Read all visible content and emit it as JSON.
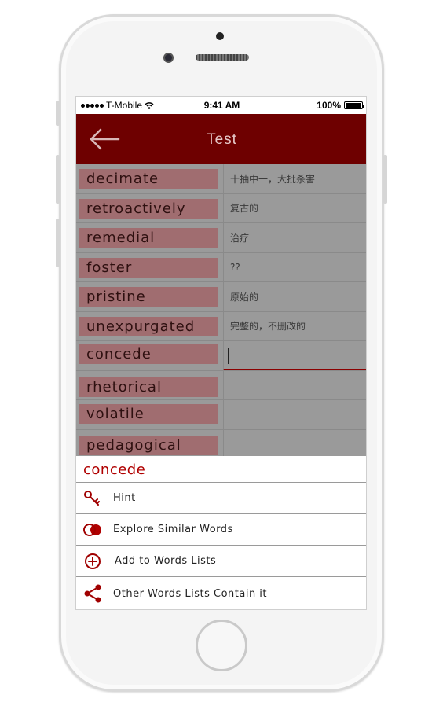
{
  "status_bar": {
    "carrier": "T-Mobile",
    "time": "9:41 AM",
    "battery": "100%"
  },
  "nav": {
    "title": "Test",
    "back_icon": "arrow-left-icon"
  },
  "words": [
    {
      "word": "decimate",
      "meaning": "十抽中一，大批杀害"
    },
    {
      "word": "retroactively",
      "meaning": "复古的"
    },
    {
      "word": "remedial",
      "meaning": "治疗"
    },
    {
      "word": "foster",
      "meaning": "??"
    },
    {
      "word": "pristine",
      "meaning": "原始的"
    },
    {
      "word": "unexpurgated",
      "meaning": "完整的，不删改的"
    },
    {
      "word": "concede",
      "meaning": ""
    },
    {
      "word": "rhetorical",
      "meaning": ""
    },
    {
      "word": "volatile",
      "meaning": ""
    },
    {
      "word": "pedagogical",
      "meaning": ""
    }
  ],
  "sheet": {
    "title": "concede",
    "items": [
      {
        "label": "Hint",
        "icon": "key-icon"
      },
      {
        "label": "Explore Similar Words",
        "icon": "venn-icon"
      },
      {
        "label": "Add to Words Lists",
        "icon": "add-circle-icon"
      },
      {
        "label": "Other Words Lists Contain it",
        "icon": "share-icon"
      }
    ]
  },
  "colors": {
    "nav_bg": "#6e0000",
    "accent": "#b00000",
    "word_bg": "#a06d70"
  }
}
